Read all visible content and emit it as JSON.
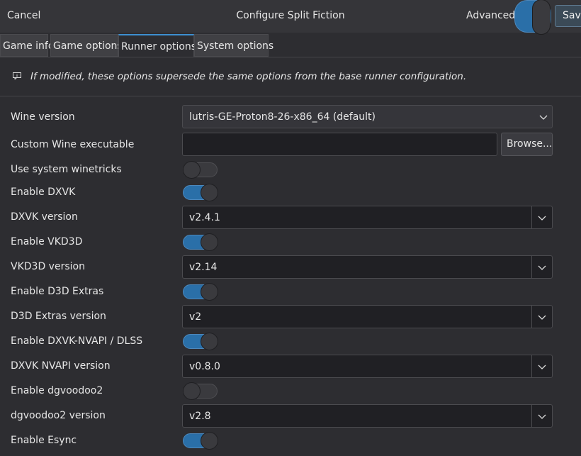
{
  "header": {
    "cancel_label": "Cancel",
    "title": "Configure Split Fiction",
    "advanced_label": "Advanced",
    "advanced_on": true,
    "save_label": "Save"
  },
  "tabs": [
    {
      "label": "Game info",
      "active": false
    },
    {
      "label": "Game options",
      "active": false
    },
    {
      "label": "Runner options",
      "active": true
    },
    {
      "label": "System options",
      "active": false
    }
  ],
  "notice": {
    "icon": "info-message-icon",
    "text": "If modified, these options supersede the same options from the base runner configuration."
  },
  "options": {
    "wine_version": {
      "label": "Wine version",
      "value": "lutris-GE-Proton8-26-x86_64 (default)"
    },
    "custom_wine": {
      "label": "Custom Wine executable",
      "value": "",
      "browse_label": "Browse..."
    },
    "system_winetricks": {
      "label": "Use system winetricks",
      "on": false
    },
    "enable_dxvk": {
      "label": "Enable DXVK",
      "on": true
    },
    "dxvk_version": {
      "label": "DXVK version",
      "value": "v2.4.1"
    },
    "enable_vkd3d": {
      "label": "Enable VKD3D",
      "on": true
    },
    "vkd3d_version": {
      "label": "VKD3D version",
      "value": "v2.14"
    },
    "enable_d3d_extras": {
      "label": "Enable D3D Extras",
      "on": true
    },
    "d3d_extras_version": {
      "label": "D3D Extras version",
      "value": "v2"
    },
    "enable_dxvk_nvapi": {
      "label": "Enable DXVK-NVAPI / DLSS",
      "on": true
    },
    "dxvk_nvapi_version": {
      "label": "DXVK NVAPI version",
      "value": "v0.8.0"
    },
    "enable_dgvoodoo2": {
      "label": "Enable dgvoodoo2",
      "on": false
    },
    "dgvoodoo2_version": {
      "label": "dgvoodoo2 version",
      "value": "v2.8"
    },
    "enable_esync": {
      "label": "Enable Esync",
      "on": true
    }
  },
  "colors": {
    "accent": "#2a6fa8",
    "background": "#2d2d31"
  }
}
